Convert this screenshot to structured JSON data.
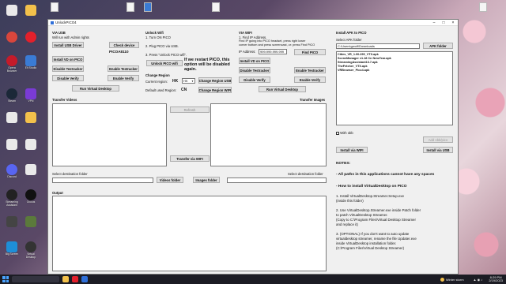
{
  "desktop": {
    "icons": [
      {
        "label": "",
        "icon": "app-icon",
        "color": "#d9463c"
      },
      {
        "label": "",
        "icon": "opera-icon",
        "color": "#e3202b"
      },
      {
        "label": "Opera Browser",
        "icon": "opera-gx-icon",
        "color": "#c51b2a"
      },
      {
        "label": "Elt Studio",
        "icon": "app-icon",
        "color": "#3a7bd5"
      },
      {
        "label": "Steam",
        "icon": "steam-icon",
        "color": "#1b2838"
      },
      {
        "label": "VPN",
        "icon": "vpn-icon",
        "color": "#7a3bd5"
      },
      {
        "label": "Discord",
        "icon": "discord-icon",
        "color": "#5865f2"
      },
      {
        "label": "Streaming Assistant",
        "icon": "oculus-icon",
        "color": "#222"
      },
      {
        "label": "Oculus",
        "icon": "oculus-icon",
        "color": "#111"
      },
      {
        "label": "Big Screen",
        "icon": "app-icon",
        "color": "#1e8fd8"
      },
      {
        "label": "Virtual Desktop",
        "icon": "vd-icon",
        "color": "#333"
      },
      {
        "label": "",
        "icon": "file-icon",
        "color": "#e9e9e9"
      }
    ]
  },
  "window": {
    "title": "UnlockPICO4"
  },
  "usb": {
    "header": "VIA USB",
    "note": "Will run with Admin rights",
    "install_usb_driver": "Install USB Driver",
    "check_device": "Check device",
    "device_name": "PICOA8110",
    "install_vd": "Install VD on PICO",
    "disable_testracker": "Disable Testracker",
    "enable_testracker": "Enable Testracker",
    "disable_verify": "Disable Verify",
    "enable_verify": "Enable Verify",
    "run_vd": "Run Virtual Desktop"
  },
  "wifi_unlock": {
    "header": "Unlock Wifi",
    "step1": "1. Turn ON PICO",
    "step2": "2. Plug PICO via USB.",
    "step3": "3. Press \"Unlock PICO wifi\".",
    "unlock_button": "Unlock PICO wifi",
    "warning": "If we restart PICO, this option will be disabled again.",
    "change_region": "Change Region",
    "current_region_label": "Current region:",
    "current_region": "HK",
    "region_select": "HK",
    "change_region_usb": "Change Region USB",
    "default_region_label": "Default used Region:",
    "default_region": "CN",
    "change_region_wifi": "Change Region WIFI"
  },
  "via_wifi": {
    "header": "VIA WIFI",
    "step1": "1. Find IP Address.",
    "step1b": "Find IP going into PICO headset, press right lower",
    "step1c": "corner bottom and press screencast, or: press Find PICO",
    "ip_label": "IP Address:",
    "ip_value": "999.999.999.999",
    "find_pico": "Find PICO",
    "install_vd": "Install VD on PICO",
    "disable_testracker": "Disable Testracker",
    "enable_testracker": "Enable Testracker",
    "disable_verify": "Disable Verify",
    "enable_verify": "Enable Verify",
    "run_vd": "Run Virtual Desktop"
  },
  "apk": {
    "header": "Install APK to PICO",
    "folder_label": "Select APK folder",
    "folder_value": "C:\\Users\\gwolf\\Downloads",
    "apk_folder_button": "APK folder",
    "files": [
      "Cities_VR_1.00.299_VTX.apk",
      "SceneManager v1.18 Cn NewYear.apk",
      "StreamingAssistant13.7.apk",
      "TheFetcher_VTX.apk",
      "VRBrowser_Pico4.apk"
    ],
    "with_obb": "With obb",
    "add_obb": "Add obb/pico",
    "install_wifi": "Install via WIFI",
    "install_usb": "Install via USB"
  },
  "transfer": {
    "videos_label": "Transfer Videos",
    "images_label": "Transfer Images",
    "refresh": "Refresh",
    "transfer_wifi": "Transfer via WIFI",
    "src_folder_label": "Select destination folder",
    "dst_folder_label": "Select destination folder",
    "videos_folder": "Videos folder",
    "images_folder": "Images folder"
  },
  "output": {
    "label": "Output"
  },
  "notes": {
    "title": "NOTES:",
    "lines": [
      "- All paths in this applications cannot have any spaces",
      "- How to install VirtualDesktop on PICO",
      "1. Install VirtualDesktop.Streamer.Setup.exe",
      "(inside this folder)",
      "2. Use VirtualDesktop.Streamer.exe inside Patch folder",
      "to patch VirtualDesktop Streamer.",
      "(Copy to C:\\Program Files\\Virtual Desktop Streamer",
      "and replace it)",
      "3. (OPTIONAL) If you don't want to auto update",
      "virtualdesktop streamer, rename the file Updater.exe",
      "inside VirtualDesktop installation folder.",
      "(C:\\Program Files\\Virtual Desktop Streamer)"
    ]
  },
  "taskbar": {
    "weather": "Winter storm",
    "time": "8:29 PM",
    "date": "2/19/2023"
  }
}
